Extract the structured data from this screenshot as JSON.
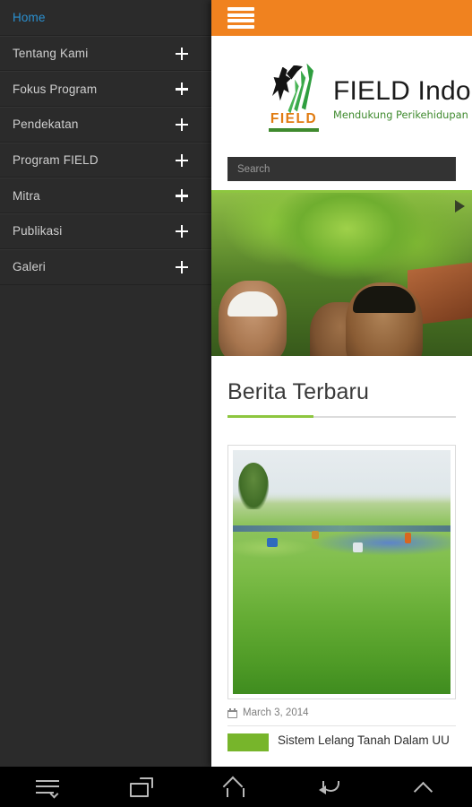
{
  "sidebar": {
    "items": [
      {
        "label": "Home",
        "expandable": false,
        "active": true
      },
      {
        "label": "Tentang Kami",
        "expandable": true,
        "active": false
      },
      {
        "label": "Fokus Program",
        "expandable": true,
        "active": false
      },
      {
        "label": "Pendekatan",
        "expandable": true,
        "active": false
      },
      {
        "label": "Program FIELD",
        "expandable": true,
        "active": false
      },
      {
        "label": "Mitra",
        "expandable": true,
        "active": false
      },
      {
        "label": "Publikasi",
        "expandable": true,
        "active": false
      },
      {
        "label": "Galeri",
        "expandable": true,
        "active": false
      }
    ]
  },
  "topbar": {
    "menu_icon": "hamburger-icon"
  },
  "branding": {
    "title": "FIELD Indo",
    "tagline": "Mendukung Perikehidupan Masya",
    "logo_word": "FIELD"
  },
  "search": {
    "value": "",
    "placeholder": "Search"
  },
  "hero": {
    "next_icon": "slider-next-arrow"
  },
  "section": {
    "title": "Berita Terbaru"
  },
  "news": [
    {
      "date": "March 3, 2014",
      "date_icon": "calendar-icon"
    }
  ],
  "next_article": {
    "title": "Sistem Lelang Tanah Dalam UU"
  },
  "navbar": {
    "buttons": [
      {
        "name": "menu-icon"
      },
      {
        "name": "recent-apps-icon"
      },
      {
        "name": "home-icon"
      },
      {
        "name": "back-icon"
      },
      {
        "name": "expand-up-icon"
      }
    ]
  },
  "colors": {
    "accent_orange": "#f0821f",
    "accent_green": "#8dc63f",
    "active_blue": "#2b90d0",
    "sidebar_bg": "#2b2b2b",
    "search_bg": "#333333"
  }
}
